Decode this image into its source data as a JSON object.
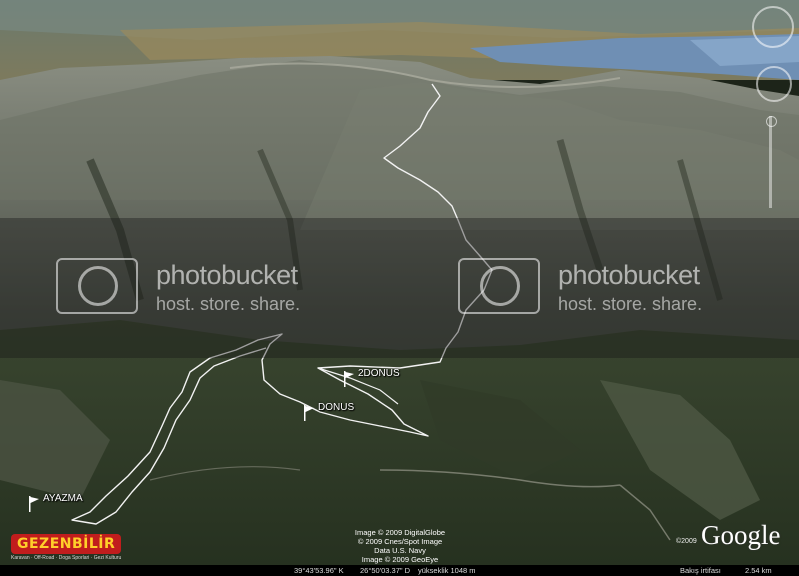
{
  "watermark": {
    "brand": "photobucket",
    "tagline": "host. store. share."
  },
  "placemarks": [
    {
      "label": "2DONUS",
      "icon": "flag-icon"
    },
    {
      "label": "DONUS",
      "icon": "flag-icon"
    },
    {
      "label": "AYAZMA",
      "icon": "flag-icon"
    }
  ],
  "site_logo": {
    "name": "GEZENBİLİR",
    "tagline": "Karavan · Off-Road · Doga Sporlari · Gezi Kulturu"
  },
  "credits": {
    "line1": "Image © 2009 DigitalGlobe",
    "line2": "© 2009 Cnes/Spot Image",
    "line3": "Data U.S. Navy",
    "line4": "Image © 2009 GeoEye"
  },
  "brand": {
    "google": "Google",
    "copyright": "©2009"
  },
  "status": {
    "lat": "39°43'53.96\" K",
    "lon": "26°50'03.37\" D",
    "elevation": "yükseklik 1048 m",
    "eye_label": "Bakış irtifası",
    "eye_value": "2.54 km"
  },
  "colors": {
    "track": "#f2f2f2",
    "lake": "#6f8fb4",
    "status_bar": "#000000"
  }
}
